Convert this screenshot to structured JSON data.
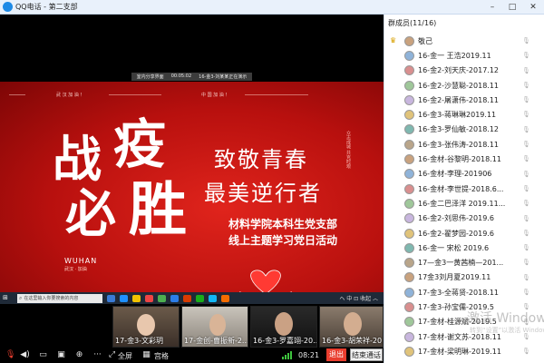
{
  "window": {
    "title": "QQ电话 - 第二支部",
    "controls": [
      "minimize-icon",
      "maximize-icon",
      "close-icon"
    ]
  },
  "share": {
    "status_bar": [
      "室内分享界面",
      "00:05:02",
      "16-金3-刘某某正在演示"
    ],
    "poster": {
      "top_left": "武 汉 加 油 ！",
      "top_right": "中 国 加 油 ！",
      "big_chars": [
        "战",
        "疫",
        "必",
        "胜"
      ],
      "wuhan_en": "WUHAN",
      "wuhan_cn": "武汉 · 加油",
      "heading1": "致敬青春",
      "heading2": "最美逆行者",
      "sub1": "材料学院本科生党支部",
      "sub2": "线上主题学习党日活动",
      "vertical": "众志成城 共克时艰"
    },
    "taskbar": {
      "search_placeholder": "在这里输入你要搜索的内容",
      "tray": "ヘ 中 ⊡ 收起 ︿"
    }
  },
  "thumbnails": [
    {
      "label": "17-金3-文彩玥"
    },
    {
      "label": "17-金创-曹振新-2..."
    },
    {
      "label": "16-金3-罗嘉翊-20..."
    },
    {
      "label": "16-金3-胡荣祥-20..."
    }
  ],
  "toolbar": {
    "screen_label": "全屏",
    "layout_label": "宫格",
    "time": "08:21",
    "exit_label": "退出",
    "end_label": "结束通话"
  },
  "members": {
    "header": "群成员(11/16)",
    "list": [
      {
        "name": "敬己",
        "badge": true
      },
      {
        "name": "16-金一 王浩2019.11"
      },
      {
        "name": "16-金2-刘天庆-2017.12"
      },
      {
        "name": "16-金2-沙慧聪-2018.11"
      },
      {
        "name": "16-金2-屠潇伟-2018.11"
      },
      {
        "name": "16-金3-蒋琳琳2019.11"
      },
      {
        "name": "16-金3-罗仙敏-2018.12"
      },
      {
        "name": "16-金3-张伟涛-2018.11"
      },
      {
        "name": "16-金材-谷黎明-2018.11"
      },
      {
        "name": "16-金材-李理-201906"
      },
      {
        "name": "16-金材-李世提-2018.6..."
      },
      {
        "name": "16-金二巴泽洋 2019.11..."
      },
      {
        "name": "16-金2-刘思伟-2019.6"
      },
      {
        "name": "16-金2-翟梦园-2019.6"
      },
      {
        "name": "16-金一 宋松 2019.6"
      },
      {
        "name": "17—金3一黄茜楠—201..."
      },
      {
        "name": "17金3刘月夏2019.11"
      },
      {
        "name": "17-金3-全蒋贤-2018.11"
      },
      {
        "name": "17-金3-孙宝儒-2019.5"
      },
      {
        "name": "17-金材-桂源斌-2019.5"
      },
      {
        "name": "17-金材-谢文苏-2018.11"
      },
      {
        "name": "17-金材-梁明琳-2019.11"
      }
    ]
  },
  "watermark": {
    "line1": "激活 Windows",
    "line2": "转到“设置”以激活 Windows"
  },
  "colors": {
    "accent_red": "#e93d2e",
    "poster_red": "#c8140f",
    "signal_green": "#3ec43e"
  }
}
